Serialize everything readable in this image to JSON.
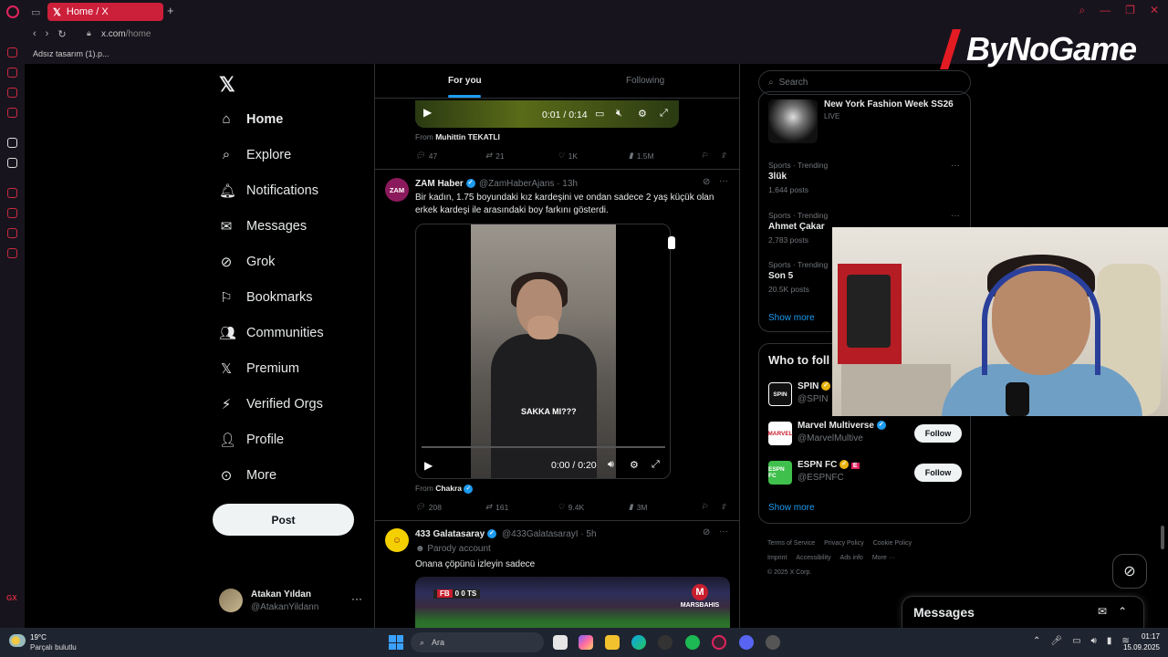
{
  "browser": {
    "tab_title": "Home / X",
    "tab_icon": "x-logo-icon",
    "url_host": "x.com",
    "url_path": "/home",
    "bookmark": "Adsız tasarım (1).p..."
  },
  "brand_overlay": {
    "text": "ByNoGame"
  },
  "x_logo": "𝕏",
  "nav": {
    "home": "Home",
    "explore": "Explore",
    "notifications": "Notifications",
    "messages": "Messages",
    "grok": "Grok",
    "bookmarks": "Bookmarks",
    "communities": "Communities",
    "premium": "Premium",
    "verified_orgs": "Verified Orgs",
    "profile": "Profile",
    "more": "More",
    "post_button": "Post"
  },
  "account": {
    "name": "Atakan Yıldan",
    "handle": "@AtakanYildann"
  },
  "timeline_tabs": {
    "for_you": "For you",
    "following": "Following"
  },
  "tweet1": {
    "video_time": "0:01 / 0:14",
    "from_label": "From",
    "from_name": "Muhittin TEKATLI",
    "replies": "47",
    "reposts": "21",
    "likes": "1K",
    "views": "1.5M"
  },
  "tweet2": {
    "avatar_text": "ZAM",
    "name": "ZAM Haber",
    "handle": "@ZamHaberAjans",
    "time": "· 13h",
    "text_line1": "Bir kadın, 1.75 boyundaki kız kardeşini ve ondan sadece 2 yaş küçük olan",
    "text_line2": "erkek kardeşi ile arasındaki boy farkını gösterdi.",
    "video_caption": "SAKKA MI???",
    "video_time": "0:00 / 0:20",
    "from_label": "From",
    "from_name": "Chakra",
    "replies": "208",
    "reposts": "161",
    "likes": "9.4K",
    "views": "3M"
  },
  "tweet3": {
    "name": "433 Galatasaray",
    "handle": "@433GalatasarayI",
    "time": "· 5h",
    "parody": "Parody account",
    "text": "Onana çöpünü izleyin sadece",
    "score_home": "FB",
    "score_value": "0  0",
    "score_away": "TS",
    "sponsor": "MARSBAHIS"
  },
  "search_placeholder": "Search",
  "trends": {
    "live_title": "New York Fashion Week SS26",
    "live_label": "LIVE",
    "items": [
      {
        "category": "Sports · Trending",
        "name": "3lük",
        "posts": "1,644 posts"
      },
      {
        "category": "Sports · Trending",
        "name": "Ahmet Çakar",
        "posts": "2,783 posts"
      },
      {
        "category": "Sports · Trending",
        "name": "Son 5",
        "posts": "20.5K posts"
      }
    ],
    "show_more": "Show more"
  },
  "who_to_follow": {
    "title": "Who to foll",
    "items": [
      {
        "avatar": "SPIN",
        "name": "SPIN",
        "handle": "@SPIN"
      },
      {
        "avatar": "MARVEL",
        "name": "Marvel Multiverse",
        "handle": "@MarvelMultive",
        "button": "Follow"
      },
      {
        "avatar": "ESPN FC",
        "name": "ESPN FC",
        "handle": "@ESPNFC",
        "button": "Follow"
      }
    ],
    "show_more": "Show more"
  },
  "footer": {
    "terms": "Terms of Service",
    "privacy": "Privacy Policy",
    "cookie": "Cookie Policy",
    "imprint": "Imprint",
    "accessibility": "Accessibility",
    "ads": "Ads info",
    "more": "More ···",
    "copyright": "© 2025 X Corp."
  },
  "messages_drawer": {
    "title": "Messages"
  },
  "taskbar": {
    "temp": "19°C",
    "weather": "Parçalı bulutlu",
    "search": "Ara",
    "time": "01:17",
    "date": "15.09.2025"
  },
  "colors": {
    "accent": "#1d9bf0",
    "opera_red": "#cc1f3a",
    "background": "#000000"
  }
}
